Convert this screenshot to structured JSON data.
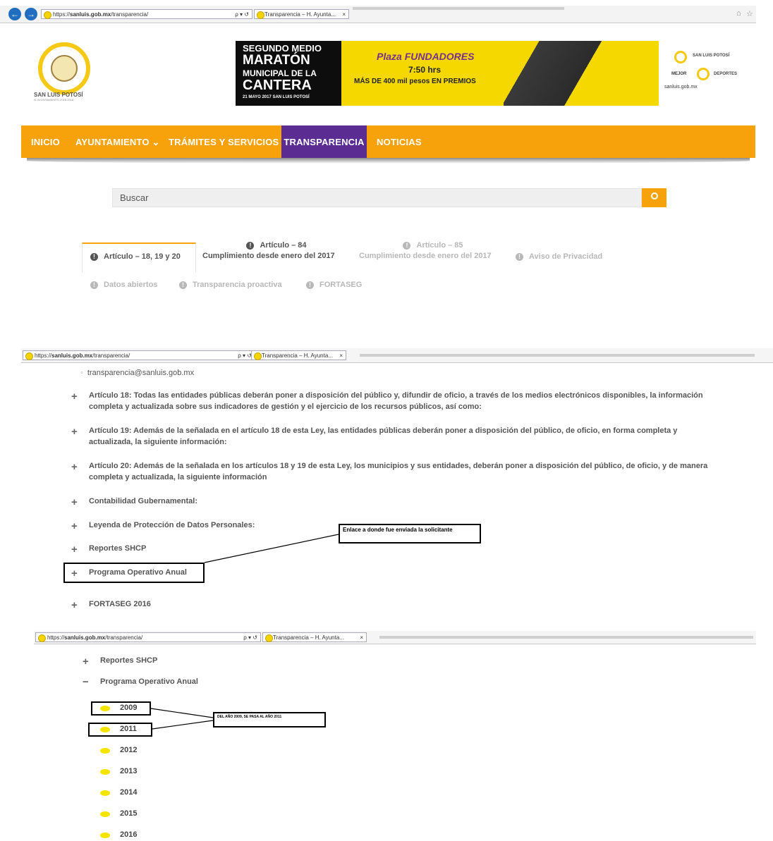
{
  "browser": {
    "url_prefix": "https://",
    "url_domain": "sanluis.gob.mx",
    "url_path": "/transparencia/",
    "tab_title": "Transparencia – H. Ayunta...",
    "search_glyph": "ρ ▾ ↺",
    "close_glyph": "×"
  },
  "header": {
    "logo_text": "SAN LUIS POTOSÍ",
    "logo_subtext": "H. AYUNTAMIENTO 2015-2018",
    "banner": {
      "line1": "SEGUNDO MEDIO",
      "line2": "MARATÓN",
      "line3": "MUNICIPAL DE LA",
      "line4": "CANTERA",
      "date": "21 MAYO 2017 SAN LUIS POTOSÍ",
      "plaza": "Plaza FUNDADORES",
      "time": "7:50 hrs",
      "prize": "MÁS DE 400 mil pesos EN PREMIOS"
    },
    "right_logo_1": "SAN LUIS POTOSÍ",
    "right_logo_2": "MEJOR",
    "right_logo_3": "DEPORTES",
    "right_site": "sanluis.gob.mx",
    "colors": {
      "accent": "#f8a20b",
      "active": "#5b2c91"
    }
  },
  "menu": {
    "items": [
      "INICIO",
      "AYUNTAMIENTO ⌄",
      "TRÁMITES Y SERVICIOS ⌄",
      "TRANSPARENCIA",
      "NOTICIAS"
    ]
  },
  "search": {
    "placeholder": "Buscar",
    "icon": "search-icon"
  },
  "tabs": {
    "row1": [
      {
        "line1": "",
        "line2": "Artículo – 18, 19 y 20"
      },
      {
        "line1": "Artículo – 84",
        "line2": "Cumplimiento desde enero del 2017"
      },
      {
        "line1": "Artículo – 85",
        "line2": "Cumplimiento desde enero del 2017"
      },
      {
        "line1": "",
        "line2": "Aviso de Privacidad"
      }
    ],
    "row2": [
      "Datos abiertos",
      "Transparencia proactiva",
      "FORTASEG"
    ]
  },
  "section2": {
    "email": "transparencia@sanluis.gob.mx",
    "items": [
      "Artículo 18: Todas las entidades públicas deberán poner a disposición del público y, difundir de oficio, a través de los medios electrónicos disponibles, la información completa y actualizada sobre sus indicadores de gestión y el ejercicio de los recursos públicos, así como:",
      "Artículo 19: Además de la señalada en el artículo 18 de esta Ley, las entidades públicas deberán poner a disposición del público, de oficio, en forma completa y actualizada, la siguiente información:",
      "Artículo 20: Además de la señalada en los artículos 18 y 19 de esta Ley, los municipios y sus entidades, deberán poner a disposición del público, de oficio, y de manera completa y actualizada, la siguiente información",
      "Contabilidad Gubernamental:",
      "Leyenda de Protección de Datos Personales:",
      "Reportes SHCP",
      "Programa Operativo Anual",
      "FORTASEG 2016"
    ],
    "callout": "Enlace a donde fue enviada la solicitante"
  },
  "section3": {
    "reportes": "Reportes SHCP",
    "programa": "Programa Operativo Anual",
    "years": [
      "2009",
      "2011",
      "2012",
      "2013",
      "2014",
      "2015",
      "2016"
    ],
    "callout": "DEL AÑO 2009, SE PASA AL AÑO 2011"
  }
}
